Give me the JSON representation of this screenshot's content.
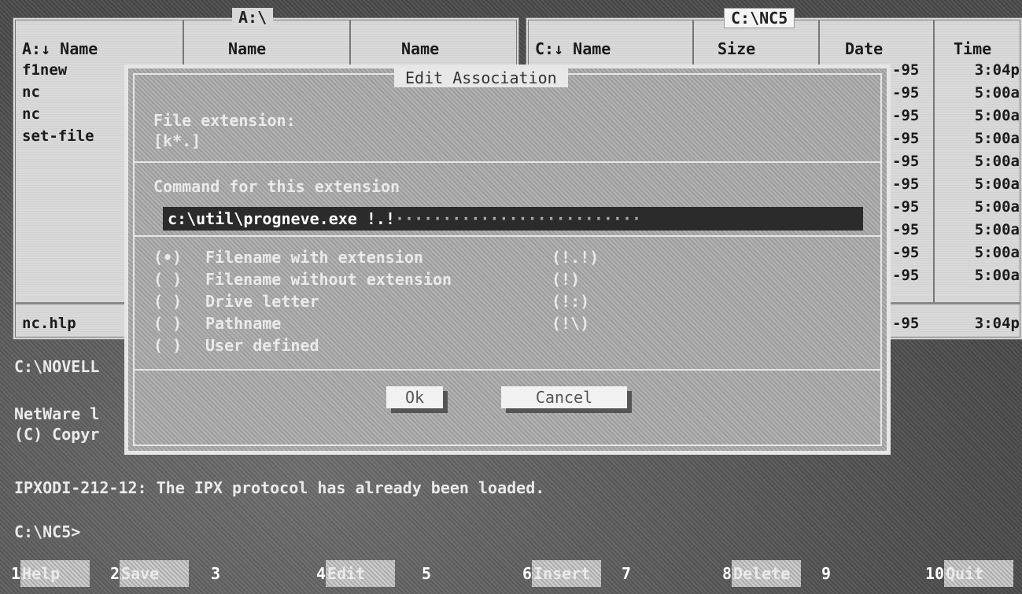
{
  "left_panel": {
    "title": "A:\\",
    "col1_header": "A:↓ Name",
    "col2_header": "Name",
    "col3_header": "Name",
    "files": [
      "f1new",
      "nc",
      "nc",
      "set-file"
    ],
    "footer_file": "nc.hlp"
  },
  "right_panel": {
    "title": "C:\\NC5",
    "col_name_header": "C:↓ Name",
    "col_size_header": "Size",
    "col_date_header": "Date",
    "col_time_header": "Time",
    "rows": [
      {
        "date": "-95",
        "time": "3:04p"
      },
      {
        "date": "-95",
        "time": "5:00a"
      },
      {
        "date": "-95",
        "time": "5:00a"
      },
      {
        "date": "-95",
        "time": "5:00a"
      },
      {
        "date": "-95",
        "time": "5:00a"
      },
      {
        "date": "-95",
        "time": "5:00a"
      },
      {
        "date": "-95",
        "time": "5:00a"
      },
      {
        "date": "-95",
        "time": "5:00a"
      },
      {
        "date": "-95",
        "time": "5:00a"
      },
      {
        "date": "-95",
        "time": "5:00a"
      }
    ],
    "footer_date": "-95",
    "footer_time": "3:04p"
  },
  "dialog": {
    "title": "Edit Association",
    "extension_label": "File extension:",
    "extension_value": "[k*.]",
    "command_label": "Command for this extension",
    "command_value": "c:\\util\\progneve.exe !.!",
    "command_fill": "··························",
    "options": [
      {
        "mark": "(•)",
        "label": "Filename with extension",
        "code": "(!.!)"
      },
      {
        "mark": "( )",
        "label": "Filename without extension",
        "code": "(!)"
      },
      {
        "mark": "( )",
        "label": "Drive letter",
        "code": "(!:)"
      },
      {
        "mark": "( )",
        "label": "Pathname",
        "code": "(!\\)"
      },
      {
        "mark": "( )",
        "label": "User defined",
        "code": ""
      }
    ],
    "ok_label": "Ok",
    "cancel_label": "Cancel"
  },
  "console": {
    "line1": "C:\\NOVELL",
    "line2": "NetWare l",
    "line3": "(C) Copyr",
    "line4": "IPXODI-212-12: The IPX protocol has already been loaded.",
    "prompt": "C:\\NC5>"
  },
  "fkeys": [
    {
      "num": "1",
      "label": "Help"
    },
    {
      "num": "2",
      "label": "Save"
    },
    {
      "num": "3",
      "label": ""
    },
    {
      "num": "4",
      "label": "Edit"
    },
    {
      "num": "5",
      "label": ""
    },
    {
      "num": "6",
      "label": "Insert"
    },
    {
      "num": "7",
      "label": ""
    },
    {
      "num": "8",
      "label": "Delete"
    },
    {
      "num": "9",
      "label": ""
    },
    {
      "num": "10",
      "label": "Quit"
    }
  ]
}
